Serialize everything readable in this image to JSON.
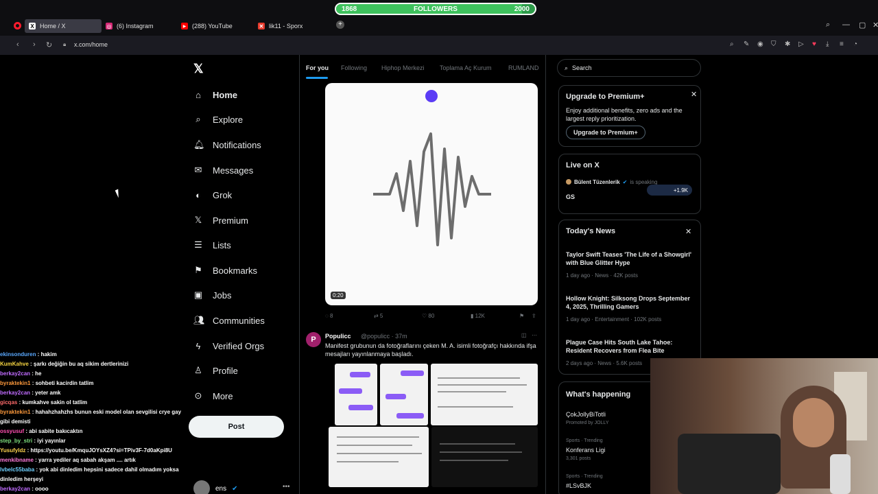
{
  "followers": {
    "current": "1868",
    "label": "FOLLOWERS",
    "goal": "2000",
    "progress": 0.934
  },
  "browser": {
    "tabs": [
      {
        "label": "Home / X",
        "icon": "x-logo-icon",
        "active": true
      },
      {
        "label": "(6) Instagram",
        "icon": "instagram-icon",
        "active": false
      },
      {
        "label": "(288) YouTube",
        "icon": "youtube-icon",
        "active": false
      },
      {
        "label": "lik11 - Sporx",
        "icon": "sporx-icon",
        "active": false
      }
    ],
    "url": "x.com/home"
  },
  "sidebar": {
    "items": [
      {
        "label": "Home",
        "icon": "home-icon"
      },
      {
        "label": "Explore",
        "icon": "search-icon"
      },
      {
        "label": "Notifications",
        "icon": "bell-icon"
      },
      {
        "label": "Messages",
        "icon": "envelope-icon"
      },
      {
        "label": "Grok",
        "icon": "grok-icon"
      },
      {
        "label": "Premium",
        "icon": "x-logo-icon"
      },
      {
        "label": "Lists",
        "icon": "list-icon"
      },
      {
        "label": "Bookmarks",
        "icon": "bookmark-icon"
      },
      {
        "label": "Jobs",
        "icon": "briefcase-icon"
      },
      {
        "label": "Communities",
        "icon": "people-icon"
      },
      {
        "label": "Verified Orgs",
        "icon": "lightning-icon"
      },
      {
        "label": "Profile",
        "icon": "person-icon"
      },
      {
        "label": "More",
        "icon": "more-circle-icon"
      }
    ],
    "post_label": "Post",
    "account_name": "ens"
  },
  "feed": {
    "tabs": [
      "For you",
      "Following",
      "Hiphop Merkezi",
      "Toplama Aç Kurum",
      "RUMLAND"
    ],
    "video_time": "0:20",
    "tweet2": {
      "avatar_letter": "P",
      "name": "Populicc",
      "meta": "@populicc · 37m",
      "text": "Manifest grubunun da fotoğraflarını çeken M. A. isimli fotoğrafçı hakkında ifşa mesajları yayınlanmaya başladı."
    }
  },
  "right": {
    "search_placeholder": "Search",
    "premium": {
      "title": "Upgrade to Premium+",
      "text": "Enjoy additional benefits, zero ads and the largest reply prioritization.",
      "button": "Upgrade to Premium+"
    },
    "live": {
      "title": "Live on X",
      "host": "Bülent Tüzenlerik",
      "status": "is speaking",
      "topic": "GS",
      "count": "+1.9K"
    },
    "news": {
      "title": "Today's News",
      "items": [
        {
          "headline": "Taylor Swift Teases 'The Life of a Showgirl' with Blue Glitter Hype",
          "meta": "1 day ago · News · 42K posts"
        },
        {
          "headline": "Hollow Knight: Silksong Drops September 4, 2025, Thrilling Gamers",
          "meta": "1 day ago · Entertainment · 102K posts"
        },
        {
          "headline": "Plague Case Hits South Lake Tahoe: Resident Recovers from Flea Bite",
          "meta": "2 days ago · News · 5.6K posts"
        }
      ]
    },
    "happening": {
      "title": "What's happening",
      "items": [
        {
          "label": "ÇokJollyBiTotli",
          "sub": "Promoted by JOLLY"
        },
        {
          "label": "Konferans Ligi",
          "sub": "Sports · Trending",
          "extra": "3,301 posts"
        },
        {
          "label": "#LSvBJK",
          "sub": "Sports · Trending"
        }
      ]
    }
  },
  "chat": [
    {
      "user": "ekinsonduren",
      "color": "#5aa9ff",
      "msg": "hakim"
    },
    {
      "user": "KumKahve",
      "color": "#f5d442",
      "msg": "şarkı değiğin bu aq sikim dertlerinizi"
    },
    {
      "user": "berkay2can",
      "color": "#c06cff",
      "msg": "he"
    },
    {
      "user": "byraktekin1",
      "color": "#ff9a3c",
      "msg": "sohbeti kacirdin tatlim"
    },
    {
      "user": "berkay2can",
      "color": "#c06cff",
      "msg": "yeter amk"
    },
    {
      "user": "gicqas",
      "color": "#ff6b6b",
      "msg": "kumkahve sakin ol tatlim"
    },
    {
      "user": "byraktekin1",
      "color": "#ff9a3c",
      "msg": "hahahzhahzhs bunun eski model olan sevgilisi crye gay gibi demisti"
    },
    {
      "user": "ossyusuf",
      "color": "#ff4fb0",
      "msg": "abi sabite bakıcaktın"
    },
    {
      "user": "step_by_stri",
      "color": "#7ee07e",
      "msg": "iyi yayınlar"
    },
    {
      "user": "Yusufyldz",
      "color": "#ffd54f",
      "msg": "https://youtu.be/KmquJOYsXZ4?si=TPiv3F-7d0aKpi8U"
    },
    {
      "user": "menkibname",
      "color": "#ff7ad9",
      "msg": "yarra yediler aq sabah akşam .... artık"
    },
    {
      "user": "lvbelc55baba",
      "color": "#6fd1ff",
      "msg": "yok abi dinledim hepsini sadece dahil olmadım yoksa dinledim herşeyi"
    },
    {
      "user": "berkay2can",
      "color": "#c06cff",
      "msg": "oooo"
    }
  ]
}
